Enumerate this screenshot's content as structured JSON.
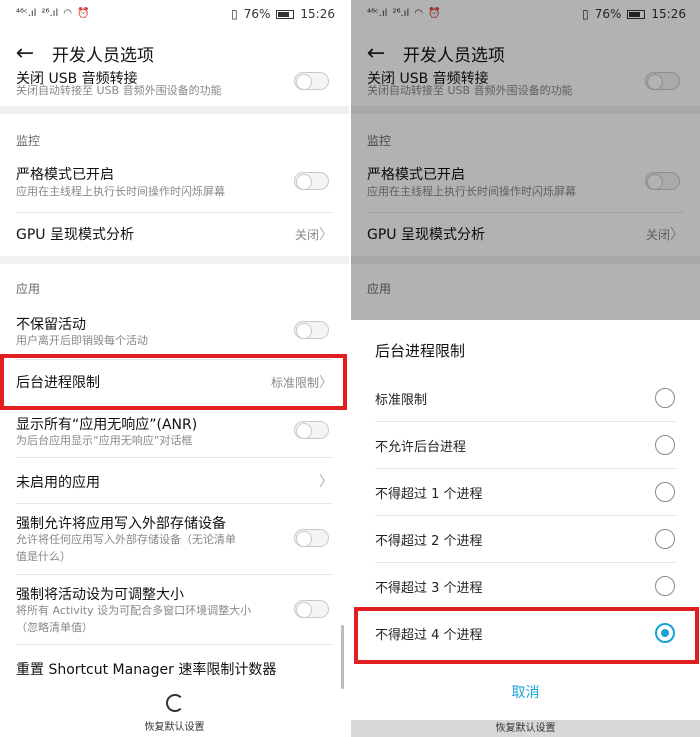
{
  "status": {
    "left_a": "⁴⁶ᶜ.ıl",
    "left_b": "²⁶.ıl",
    "battery": "76%",
    "time": "15:26"
  },
  "toolbar": {
    "title": "开发人员选项"
  },
  "settings": {
    "usb_title": "关闭 USB 音频转接",
    "usb_sub": "关闭自动转接至 USB 音频外围设备的功能",
    "monitor_header": "监控",
    "strict_title": "严格模式已开启",
    "strict_sub": "应用在主线程上执行长时间操作时闪烁屏幕",
    "gpu_title": "GPU 呈现模式分析",
    "gpu_value": "关闭",
    "app_header": "应用",
    "keep_title": "不保留活动",
    "keep_sub": "用户离开后即销毁每个活动",
    "bg_title": "后台进程限制",
    "bg_value": "标准限制",
    "anr_title": "显示所有“应用无响应”(ANR)",
    "anr_sub": "为后台应用显示“应用无响应”对话框",
    "inactive_title": "未启用的应用",
    "ext_title": "强制允许将应用写入外部存储设备",
    "ext_sub1": "允许将任何应用写入外部存储设备（无论清单",
    "ext_sub2": "值是什么）",
    "resize_title": "强制将活动设为可调整大小",
    "resize_sub1": "将所有 Activity 设为可配合多窗口环境调整大小",
    "resize_sub2": "（忽略清单值）",
    "shortcut_title": "重置 Shortcut Manager 速率限制计数器"
  },
  "bottom": {
    "restore_label": "恢复默认设置"
  },
  "dialog": {
    "title": "后台进程限制",
    "options": [
      {
        "label": "标准限制",
        "selected": false
      },
      {
        "label": "不允许后台进程",
        "selected": false
      },
      {
        "label": "不得超过 1 个进程",
        "selected": false
      },
      {
        "label": "不得超过 2 个进程",
        "selected": false
      },
      {
        "label": "不得超过 3 个进程",
        "selected": false
      },
      {
        "label": "不得超过 4 个进程",
        "selected": true
      }
    ],
    "cancel": "取消"
  },
  "colors": {
    "accent": "#1aa3d9",
    "highlight": "#e02020"
  }
}
